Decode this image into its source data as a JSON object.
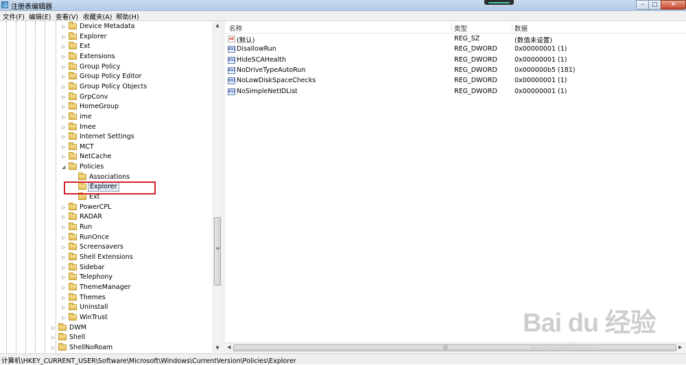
{
  "window": {
    "title": "注册表编辑器",
    "min": "–",
    "max": "□",
    "close": "✕"
  },
  "menu": [
    "文件(F)",
    "编辑(E)",
    "查看(V)",
    "收藏夹(A)",
    "帮助(H)"
  ],
  "tree": {
    "nodes": [
      {
        "label": "Device Metadata",
        "expander": "collapsed",
        "depth": 2
      },
      {
        "label": "Explorer",
        "expander": "collapsed",
        "depth": 2
      },
      {
        "label": "Ext",
        "expander": "collapsed",
        "depth": 2
      },
      {
        "label": "Extensions",
        "expander": "collapsed",
        "depth": 2
      },
      {
        "label": "Group Policy",
        "expander": "collapsed",
        "depth": 2
      },
      {
        "label": "Group Policy Editor",
        "expander": "collapsed",
        "depth": 2
      },
      {
        "label": "Group Policy Objects",
        "expander": "collapsed",
        "depth": 2
      },
      {
        "label": "GrpConv",
        "expander": "collapsed",
        "depth": 2
      },
      {
        "label": "HomeGroup",
        "expander": "collapsed",
        "depth": 2
      },
      {
        "label": "ime",
        "expander": "collapsed",
        "depth": 2
      },
      {
        "label": "Imee",
        "expander": "collapsed",
        "depth": 2
      },
      {
        "label": "Internet Settings",
        "expander": "collapsed",
        "depth": 2
      },
      {
        "label": "MCT",
        "expander": "collapsed",
        "depth": 2
      },
      {
        "label": "NetCache",
        "expander": "collapsed",
        "depth": 2
      },
      {
        "label": "Policies",
        "expander": "expanded",
        "depth": 2
      },
      {
        "label": "Associations",
        "expander": "none",
        "depth": 3
      },
      {
        "label": "Explorer",
        "expander": "none",
        "depth": 3,
        "selected": true
      },
      {
        "label": "Ext",
        "expander": "none",
        "depth": 3
      },
      {
        "label": "PowerCPL",
        "expander": "collapsed",
        "depth": 2
      },
      {
        "label": "RADAR",
        "expander": "collapsed",
        "depth": 2
      },
      {
        "label": "Run",
        "expander": "collapsed",
        "depth": 2
      },
      {
        "label": "RunOnce",
        "expander": "collapsed",
        "depth": 2
      },
      {
        "label": "Screensavers",
        "expander": "collapsed",
        "depth": 2
      },
      {
        "label": "Shell Extensions",
        "expander": "collapsed",
        "depth": 2
      },
      {
        "label": "Sidebar",
        "expander": "collapsed",
        "depth": 2
      },
      {
        "label": "Telephony",
        "expander": "collapsed",
        "depth": 2
      },
      {
        "label": "ThemeManager",
        "expander": "collapsed",
        "depth": 2
      },
      {
        "label": "Themes",
        "expander": "collapsed",
        "depth": 2
      },
      {
        "label": "Uninstall",
        "expander": "collapsed",
        "depth": 2
      },
      {
        "label": "WinTrust",
        "expander": "collapsed",
        "depth": 2
      },
      {
        "label": "DWM",
        "expander": "collapsed",
        "depth": 1
      },
      {
        "label": "Shell",
        "expander": "collapsed",
        "depth": 1
      },
      {
        "label": "ShellNoRoam",
        "expander": "collapsed",
        "depth": 1
      }
    ]
  },
  "list": {
    "columns": [
      "名称",
      "类型",
      "数据"
    ],
    "rows": [
      {
        "icon": "string-value-icon",
        "name": "(默认)",
        "type": "REG_SZ",
        "data": "(数值未设置)"
      },
      {
        "icon": "dword-value-icon",
        "name": "DisallowRun",
        "type": "REG_DWORD",
        "data": "0x00000001 (1)"
      },
      {
        "icon": "dword-value-icon",
        "name": "HideSCAHealth",
        "type": "REG_DWORD",
        "data": "0x00000001 (1)"
      },
      {
        "icon": "dword-value-icon",
        "name": "NoDriveTypeAutoRun",
        "type": "REG_DWORD",
        "data": "0x000000b5 (181)"
      },
      {
        "icon": "dword-value-icon",
        "name": "NoLowDiskSpaceChecks",
        "type": "REG_DWORD",
        "data": "0x00000001 (1)"
      },
      {
        "icon": "dword-value-icon",
        "name": "NoSimpleNetIDList",
        "type": "REG_DWORD",
        "data": "0x00000001 (1)"
      }
    ]
  },
  "status": {
    "path": "计算机\\HKEY_CURRENT_USER\\Software\\Microsoft\\Windows\\CurrentVersion\\Policies\\Explorer"
  },
  "watermark": {
    "line1": "Bai du 经验",
    "line2": "jingyan.baidu.com"
  }
}
